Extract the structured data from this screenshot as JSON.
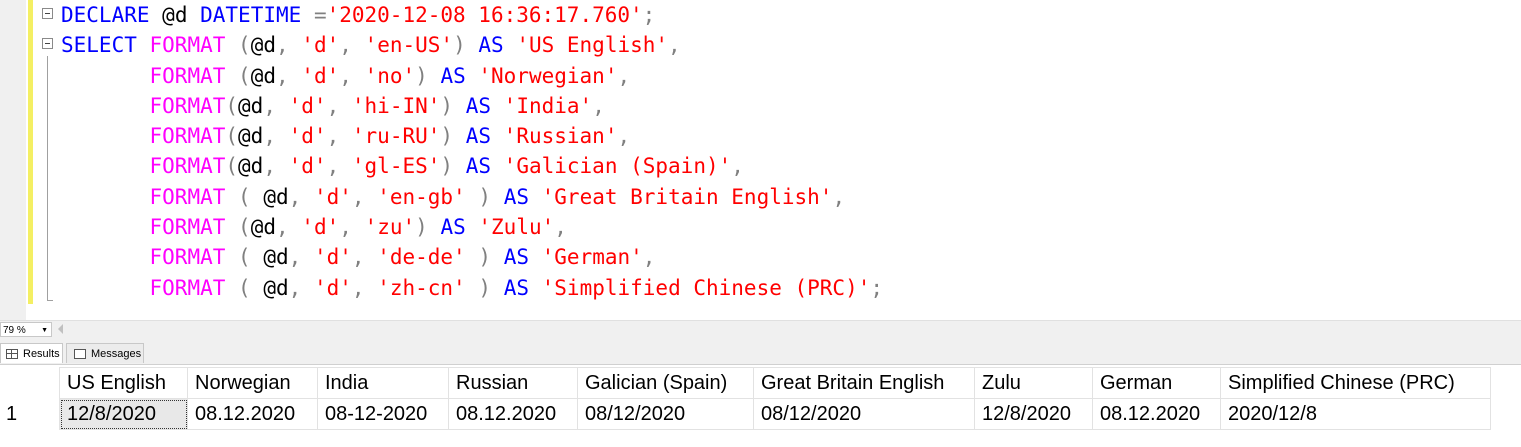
{
  "editor": {
    "lines": [
      {
        "id": "l1",
        "tokens": [
          [
            "kw",
            "DECLARE"
          ],
          [
            "",
            "@d"
          ],
          [
            "kw",
            "DATETIME"
          ],
          [
            "op",
            "="
          ],
          [
            "str",
            "'2020-12-08 16:36:17.760'"
          ],
          [
            "op",
            ";"
          ]
        ]
      },
      {
        "id": "l2",
        "tokens": [
          [
            "kw",
            "SELECT"
          ],
          [
            "fn",
            "FORMAT"
          ],
          [
            "op",
            "("
          ],
          [
            "",
            "@d"
          ],
          [
            "op",
            ","
          ],
          [
            "str",
            "'d'"
          ],
          [
            "op",
            ","
          ],
          [
            "str",
            "'en-US'"
          ],
          [
            "op",
            ")"
          ],
          [
            "kw",
            "AS"
          ],
          [
            "str",
            "'US English'"
          ],
          [
            "op",
            ","
          ]
        ]
      },
      {
        "id": "l3",
        "tokens": [
          [
            "fn",
            "FORMAT"
          ],
          [
            "op",
            "("
          ],
          [
            "",
            "@d"
          ],
          [
            "op",
            ","
          ],
          [
            "str",
            "'d'"
          ],
          [
            "op",
            ","
          ],
          [
            "str",
            "'no'"
          ],
          [
            "op",
            ")"
          ],
          [
            "kw",
            "AS"
          ],
          [
            "str",
            "'Norwegian'"
          ],
          [
            "op",
            ","
          ]
        ]
      },
      {
        "id": "l4",
        "tokens": [
          [
            "fn",
            "FORMAT"
          ],
          [
            "op",
            "("
          ],
          [
            "",
            "@d"
          ],
          [
            "op",
            ","
          ],
          [
            "str",
            "'d'"
          ],
          [
            "op",
            ","
          ],
          [
            "str",
            "'hi-IN'"
          ],
          [
            "op",
            ")"
          ],
          [
            "kw",
            "AS"
          ],
          [
            "str",
            "'India'"
          ],
          [
            "op",
            ","
          ]
        ]
      },
      {
        "id": "l5",
        "tokens": [
          [
            "fn",
            "FORMAT"
          ],
          [
            "op",
            "("
          ],
          [
            "",
            "@d"
          ],
          [
            "op",
            ","
          ],
          [
            "str",
            "'d'"
          ],
          [
            "op",
            ","
          ],
          [
            "str",
            "'ru-RU'"
          ],
          [
            "op",
            ")"
          ],
          [
            "kw",
            "AS"
          ],
          [
            "str",
            "'Russian'"
          ],
          [
            "op",
            ","
          ]
        ]
      },
      {
        "id": "l6",
        "tokens": [
          [
            "fn",
            "FORMAT"
          ],
          [
            "op",
            "("
          ],
          [
            "",
            "@d"
          ],
          [
            "op",
            ","
          ],
          [
            "str",
            "'d'"
          ],
          [
            "op",
            ","
          ],
          [
            "str",
            "'gl-ES'"
          ],
          [
            "op",
            ")"
          ],
          [
            "kw",
            "AS"
          ],
          [
            "str",
            "'Galician (Spain)'"
          ],
          [
            "op",
            ","
          ]
        ]
      },
      {
        "id": "l7",
        "tokens": [
          [
            "fn",
            "FORMAT"
          ],
          [
            "op",
            "("
          ],
          [
            "",
            "@d"
          ],
          [
            "op",
            ","
          ],
          [
            "str",
            "'d'"
          ],
          [
            "op",
            ","
          ],
          [
            "str",
            "'en-gb'"
          ],
          [
            "op",
            ")"
          ],
          [
            "kw",
            "AS"
          ],
          [
            "str",
            "'Great Britain English'"
          ],
          [
            "op",
            ","
          ]
        ]
      },
      {
        "id": "l8",
        "tokens": [
          [
            "fn",
            "FORMAT"
          ],
          [
            "op",
            "("
          ],
          [
            "",
            "@d"
          ],
          [
            "op",
            ","
          ],
          [
            "str",
            "'d'"
          ],
          [
            "op",
            ","
          ],
          [
            "str",
            "'zu'"
          ],
          [
            "op",
            ")"
          ],
          [
            "kw",
            "AS"
          ],
          [
            "str",
            "'Zulu'"
          ],
          [
            "op",
            ","
          ]
        ]
      },
      {
        "id": "l9",
        "tokens": [
          [
            "fn",
            "FORMAT"
          ],
          [
            "op",
            "("
          ],
          [
            "",
            "@d"
          ],
          [
            "op",
            ","
          ],
          [
            "str",
            "'d'"
          ],
          [
            "op",
            ","
          ],
          [
            "str",
            "'de-de'"
          ],
          [
            "op",
            ")"
          ],
          [
            "kw",
            "AS"
          ],
          [
            "str",
            "'German'"
          ],
          [
            "op",
            ","
          ]
        ]
      },
      {
        "id": "l10",
        "tokens": [
          [
            "fn",
            "FORMAT"
          ],
          [
            "op",
            "("
          ],
          [
            "",
            "@d"
          ],
          [
            "op",
            ","
          ],
          [
            "str",
            "'d'"
          ],
          [
            "op",
            ","
          ],
          [
            "str",
            "'zh-cn'"
          ],
          [
            "op",
            ")"
          ],
          [
            "kw",
            "AS"
          ],
          [
            "str",
            "'Simplified Chinese (PRC)'"
          ],
          [
            "op",
            ";"
          ]
        ]
      }
    ]
  },
  "statusbar": {
    "zoom": "79 %"
  },
  "tabs": {
    "results": "Results",
    "messages": "Messages"
  },
  "results": {
    "columns": [
      "US English",
      "Norwegian",
      "India",
      "Russian",
      "Galician (Spain)",
      "Great Britain English",
      "Zulu",
      "German",
      "Simplified Chinese (PRC)"
    ],
    "rows": [
      {
        "num": "1",
        "cells": [
          "12/8/2020",
          "08.12.2020",
          "08-12-2020",
          "08.12.2020",
          "08/12/2020",
          "08/12/2020",
          "12/8/2020",
          "08.12.2020",
          "2020/12/8"
        ]
      }
    ]
  },
  "colors": {
    "keyword": "#0000ff",
    "function": "#ff00ff",
    "string": "#ff0000",
    "operator": "#808080",
    "changebar": "#f4ef63"
  }
}
